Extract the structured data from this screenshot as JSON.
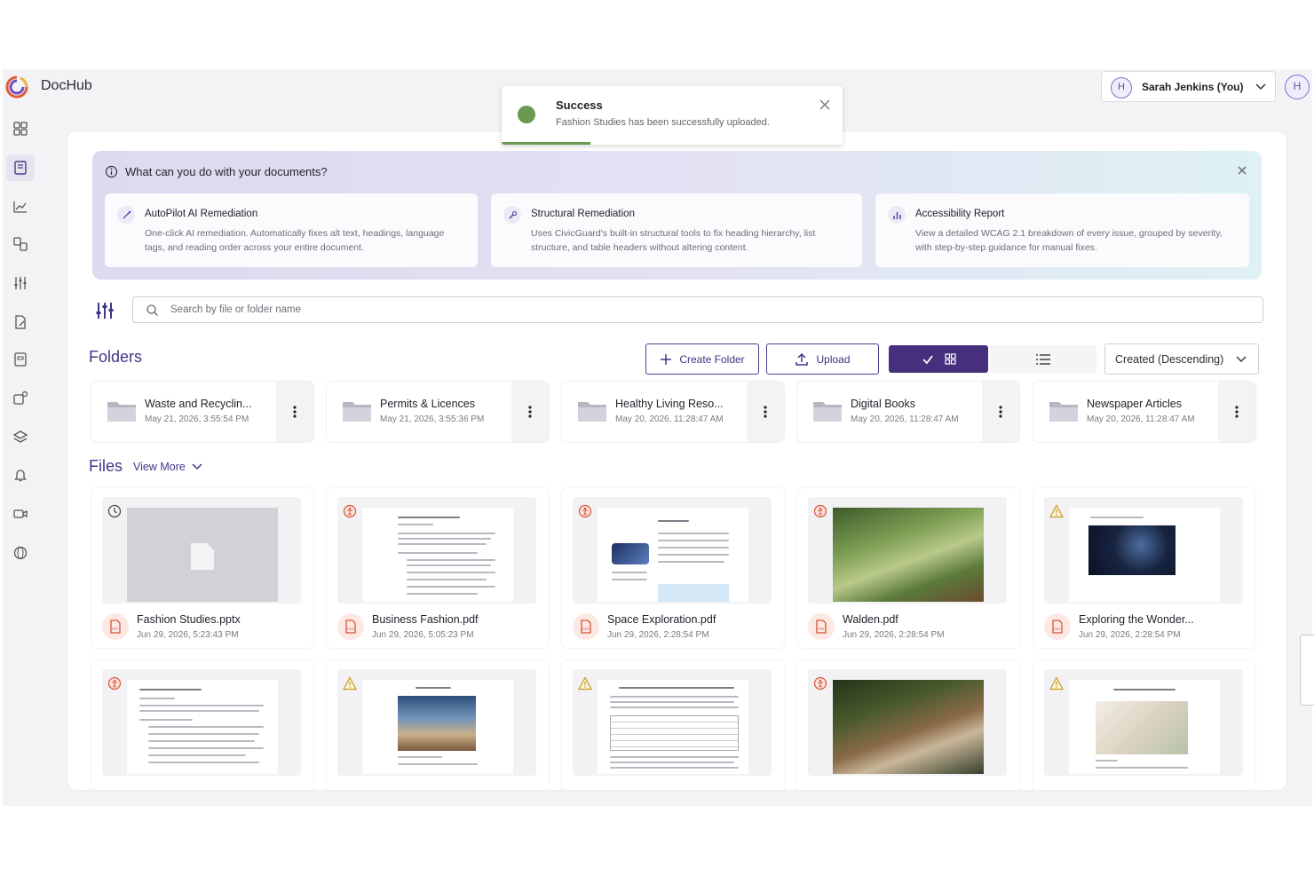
{
  "app": {
    "brand": "DocHub"
  },
  "user": {
    "initial": "H",
    "name": "Sarah Jenkins (You)"
  },
  "toast": {
    "title": "Success",
    "message": "Fashion Studies has been successfully uploaded.",
    "progress": 0.26,
    "color": "#6a9a52"
  },
  "info": {
    "title": "What can you do with your documents?",
    "cards": [
      {
        "title": "AutoPilot AI Remediation",
        "description": "One-click AI remediation. Automatically fixes alt text, headings, language tags, and reading order across your entire document."
      },
      {
        "title": "Structural Remediation",
        "description": "Uses CivicGuard's built-in structural tools to fix heading hierarchy, list structure, and table headers without altering content."
      },
      {
        "title": "Accessibility Report",
        "description": "View a detailed WCAG 2.1 breakdown of every issue, grouped by severity, with step-by-step guidance for manual fixes."
      }
    ]
  },
  "search": {
    "placeholder": "Search by file or folder name"
  },
  "folders": {
    "title": "Folders",
    "create_label": "Create Folder",
    "upload_label": "Upload",
    "sort_label": "Created (Descending)",
    "items": [
      {
        "name": "Waste and Recyclin...",
        "date": "May 21, 2026, 3:55:54 PM"
      },
      {
        "name": "Permits & Licences",
        "date": "May 21, 2026, 3:55:36 PM"
      },
      {
        "name": "Healthy Living Reso...",
        "date": "May 20, 2026, 11:28:47 AM"
      },
      {
        "name": "Digital Books",
        "date": "May 20, 2026, 11:28:47 AM"
      },
      {
        "name": "Newspaper Articles",
        "date": "May 20, 2026, 11:28:47 AM"
      }
    ]
  },
  "files": {
    "title": "Files",
    "view_more": "View More",
    "items": [
      {
        "name": "Fashion Studies.pptx",
        "date": "Jun 29, 2026, 5:23:43 PM",
        "type": "ppt",
        "status": "processing-icon"
      },
      {
        "name": "Business Fashion.pdf",
        "date": "Jun 29, 2026, 5:05:23 PM",
        "type": "pdf",
        "status": "accessibility-icon"
      },
      {
        "name": "Space Exploration.pdf",
        "date": "Jun 29, 2026, 2:28:54 PM",
        "type": "pdf",
        "status": "accessibility-icon"
      },
      {
        "name": "Walden.pdf",
        "date": "Jun 29, 2026, 2:28:54 PM",
        "type": "pdf",
        "status": "accessibility-icon"
      },
      {
        "name": "Exploring the Wonder...",
        "date": "Jun 29, 2026, 2:28:54 PM",
        "type": "pdf",
        "status": "warning-icon"
      }
    ]
  }
}
